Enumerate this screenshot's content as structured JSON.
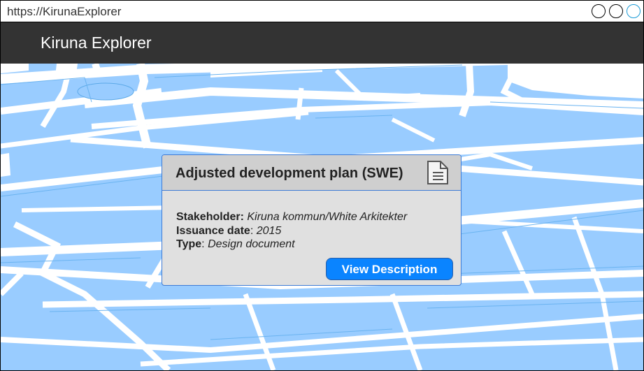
{
  "browser": {
    "url": "https://KirunaExplorer",
    "controls": [
      "minimize-icon",
      "maximize-icon",
      "close-icon"
    ]
  },
  "header": {
    "title": "Kiruna Explorer"
  },
  "map": {
    "water_color": "#99ccff",
    "road_color": "#ffffff"
  },
  "document_card": {
    "title": "Adjusted development plan (SWE)",
    "icon": "document-icon",
    "fields": {
      "stakeholder_label": "Stakeholder:",
      "stakeholder_value": "Kiruna kommun/White Arkitekter",
      "issuance_label": "Issuance date",
      "issuance_sep": ":",
      "issuance_value": "2015",
      "type_label": "Type",
      "type_sep": ":",
      "type_value": "Design document"
    },
    "button_label": "View Description",
    "accent_color": "#0a84ff",
    "border_color": "#3d7bd6"
  }
}
